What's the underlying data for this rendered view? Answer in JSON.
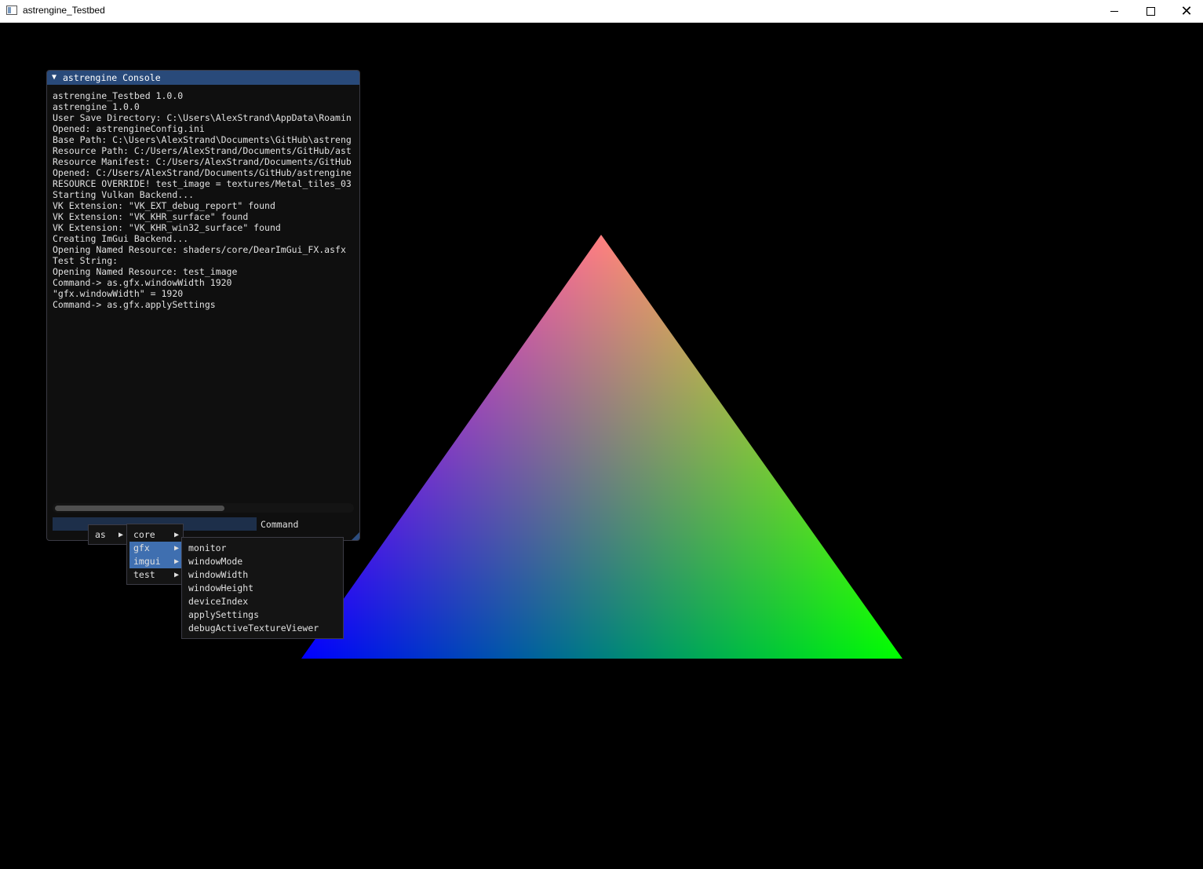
{
  "window": {
    "title": "astrengine_Testbed",
    "minimize_icon": "minimize-icon",
    "maximize_icon": "maximize-icon",
    "close_glyph": "✕"
  },
  "triangle": {
    "top_color": "#ff0000",
    "left_color": "#0000ff",
    "right_color": "#00ff00"
  },
  "console": {
    "collapse_glyph": "▼",
    "title": "astrengine Console",
    "log": [
      "astrengine_Testbed 1.0.0",
      "astrengine 1.0.0",
      "User Save Directory: C:\\Users\\AlexStrand\\AppData\\Roamin",
      "Opened: astrengineConfig.ini",
      "Base Path: C:\\Users\\AlexStrand\\Documents\\GitHub\\astreng",
      "Resource Path: C:/Users/AlexStrand/Documents/GitHub/ast",
      "Resource Manifest: C:/Users/AlexStrand/Documents/GitHub",
      "Opened: C:/Users/AlexStrand/Documents/GitHub/astrengine",
      "RESOURCE OVERRIDE! test_image = textures/Metal_tiles_03",
      "Starting Vulkan Backend...",
      "VK Extension: \"VK_EXT_debug_report\" found",
      "VK Extension: \"VK_KHR_surface\" found",
      "VK Extension: \"VK_KHR_win32_surface\" found",
      "Creating ImGui Backend...",
      "Opening Named Resource: shaders/core/DearImGui_FX.asfx",
      "Test String:",
      "Opening Named Resource: test_image",
      "Command-> as.gfx.windowWidth 1920",
      "\"gfx.windowWidth\" = 1920",
      "Command-> as.gfx.applySettings"
    ],
    "input_value": "",
    "input_label": "Command"
  },
  "menus": {
    "submenu_glyph": "▶",
    "root": [
      "as"
    ],
    "level1": [
      "core",
      "gfx",
      "imgui",
      "test"
    ],
    "level2": [
      "monitor",
      "windowMode",
      "windowWidth",
      "windowHeight",
      "deviceIndex",
      "applySettings",
      "debugActiveTextureViewer"
    ]
  },
  "colors": {
    "accent": "#3f6fb0",
    "header": "#294a7a",
    "input_bg": "#1d2f4a"
  }
}
